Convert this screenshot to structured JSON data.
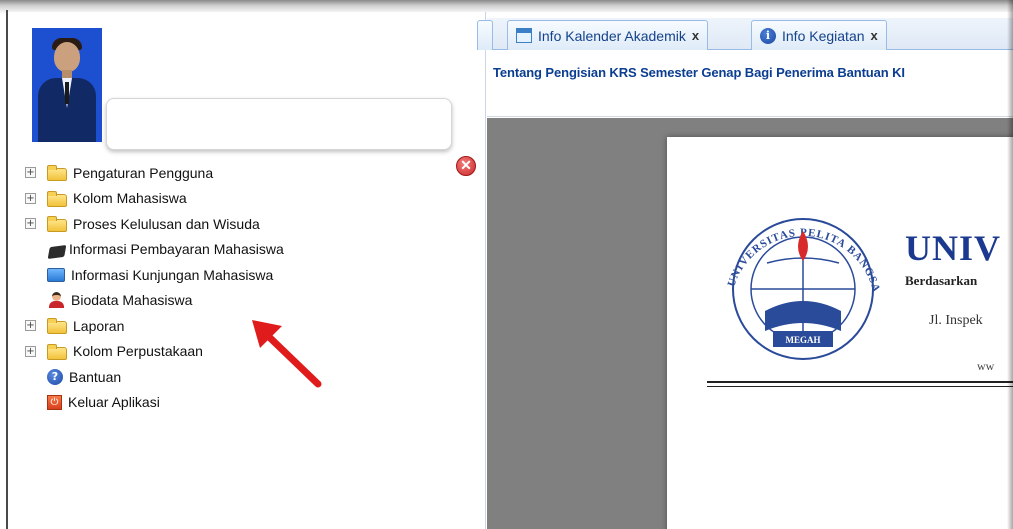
{
  "sidebar": {
    "profile": {
      "photo": "student-photo",
      "name": ""
    },
    "menu": [
      {
        "label": "Pengaturan Pengguna",
        "icon": "folder-icon",
        "expandable": true
      },
      {
        "label": "Kolom Mahasiswa",
        "icon": "folder-icon",
        "expandable": true
      },
      {
        "label": "Proses Kelulusan dan Wisuda",
        "icon": "folder-icon",
        "expandable": true
      },
      {
        "label": "Informasi Pembayaran Mahasiswa",
        "icon": "payment-card-icon",
        "expandable": false
      },
      {
        "label": "Informasi Kunjungan Mahasiswa",
        "icon": "monitor-icon",
        "expandable": false
      },
      {
        "label": "Biodata Mahasiswa",
        "icon": "student-person-icon",
        "expandable": false
      },
      {
        "label": "Laporan",
        "icon": "folder-icon",
        "expandable": true
      },
      {
        "label": "Kolom Perpustakaan",
        "icon": "folder-icon",
        "expandable": true
      },
      {
        "label": "Bantuan",
        "icon": "help-icon",
        "expandable": false
      },
      {
        "label": "Keluar Aplikasi",
        "icon": "exit-icon",
        "expandable": false
      }
    ],
    "expand_symbol": "+",
    "close_symbol": "✕"
  },
  "tabs": [
    {
      "label": "Info Kalender Akademik",
      "icon": "calendar-icon",
      "close": "x"
    },
    {
      "label": "Info Kegiatan",
      "icon": "info-icon",
      "close": "x"
    }
  ],
  "announcement": {
    "title": "Tentang Pengisian KRS Semester Genap Bagi Penerima Bantuan KI"
  },
  "document": {
    "seal_top_text": "UNIVERSITAS PELITA BANGSA",
    "seal_banner": "MEGAH",
    "heading": "UNIV",
    "subheading": "Berdasarkan",
    "address": "Jl. Inspek",
    "website": "ww"
  },
  "colors": {
    "tab_text": "#15428b",
    "announcement_text": "#0b3d91",
    "seal_blue": "#2a4a9a",
    "highlight_arrow": "#e01b1b"
  }
}
